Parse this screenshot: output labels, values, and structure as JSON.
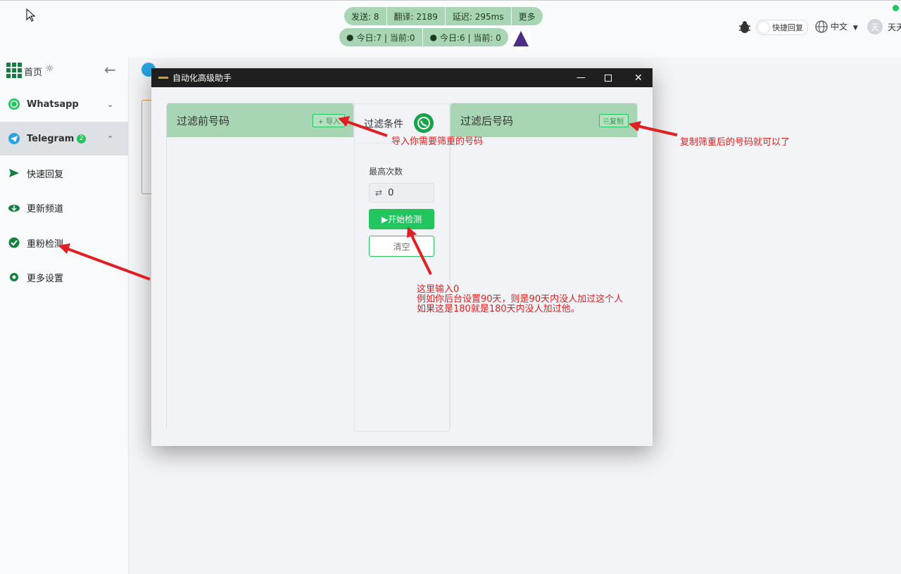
{
  "header": {
    "stats_row1": [
      "发送: 8",
      "翻译: 2189",
      "延迟: 295ms",
      "更多"
    ],
    "stats_row2": [
      "今日:7 |  当前:0",
      "今日:6 |  当前: 0"
    ],
    "quick_reply_label": "快捷回复",
    "language_label": "中文",
    "user_avatar_char": "天",
    "user_name": "天天"
  },
  "sidebar": {
    "home_label": "首页",
    "items": [
      {
        "label": "Whatsapp"
      },
      {
        "label": "Telegram",
        "badge": "2"
      },
      {
        "label": "快速回复"
      },
      {
        "label": "更新频道"
      },
      {
        "label": "重粉检测"
      },
      {
        "label": "更多设置"
      }
    ]
  },
  "dialog": {
    "title": "自动化高级助手",
    "left_panel_title": "过滤前号码",
    "import_button": "+ 导入",
    "center_title": "过滤条件",
    "max_count_label": "最高次数",
    "max_count_value": "0",
    "start_button": "▶开始检测",
    "clear_button": "清空",
    "right_panel_title": "过滤后号码",
    "copy_button": "复制"
  },
  "annotations": {
    "import_note": "导入你需要筛重的号码",
    "copy_note": "复制筛重后的号码就可以了",
    "input_note_line1": "这里输入0",
    "input_note_line2": "例如你后台设置90天，则是90天内没人加过这个人",
    "input_note_line3": "如果这是180就是180天内没人加过他。"
  },
  "colors": {
    "accent_green": "#22c55e",
    "header_green": "#a8d5b3",
    "annotation_red": "#e02020"
  }
}
